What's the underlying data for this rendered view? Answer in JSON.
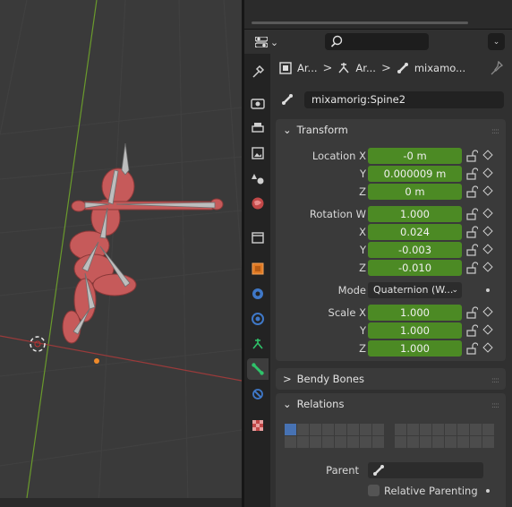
{
  "breadcrumb": {
    "items": [
      {
        "label": "Ar...",
        "icon": "object-data-icon"
      },
      {
        "label": "Ar...",
        "icon": "armature-icon"
      },
      {
        "label": "mixamo...",
        "icon": "bone-icon"
      }
    ]
  },
  "bone_name": "mixamorig:Spine2",
  "search": {
    "placeholder": ""
  },
  "panels": {
    "transform": {
      "title": "Transform",
      "location": [
        {
          "label": "Location X",
          "value": "-0 m"
        },
        {
          "label": "Y",
          "value": "0.000009 m"
        },
        {
          "label": "Z",
          "value": "0 m"
        }
      ],
      "rotation": [
        {
          "label": "Rotation W",
          "value": "1.000"
        },
        {
          "label": "X",
          "value": "0.024"
        },
        {
          "label": "Y",
          "value": "-0.003"
        },
        {
          "label": "Z",
          "value": "-0.010"
        }
      ],
      "mode": {
        "label": "Mode",
        "value": "Quaternion (W..."
      },
      "scale": [
        {
          "label": "Scale X",
          "value": "1.000"
        },
        {
          "label": "Y",
          "value": "1.000"
        },
        {
          "label": "Z",
          "value": "1.000"
        }
      ]
    },
    "bendy_bones": {
      "title": "Bendy Bones"
    },
    "relations": {
      "title": "Relations",
      "parent_label": "Parent",
      "parent_value": "",
      "relative_parenting_label": "Relative Parenting"
    }
  },
  "colors": {
    "field_green": "#4c8a24",
    "accent_blue": "#4772b3",
    "panel_bg": "#3a3a3a"
  }
}
